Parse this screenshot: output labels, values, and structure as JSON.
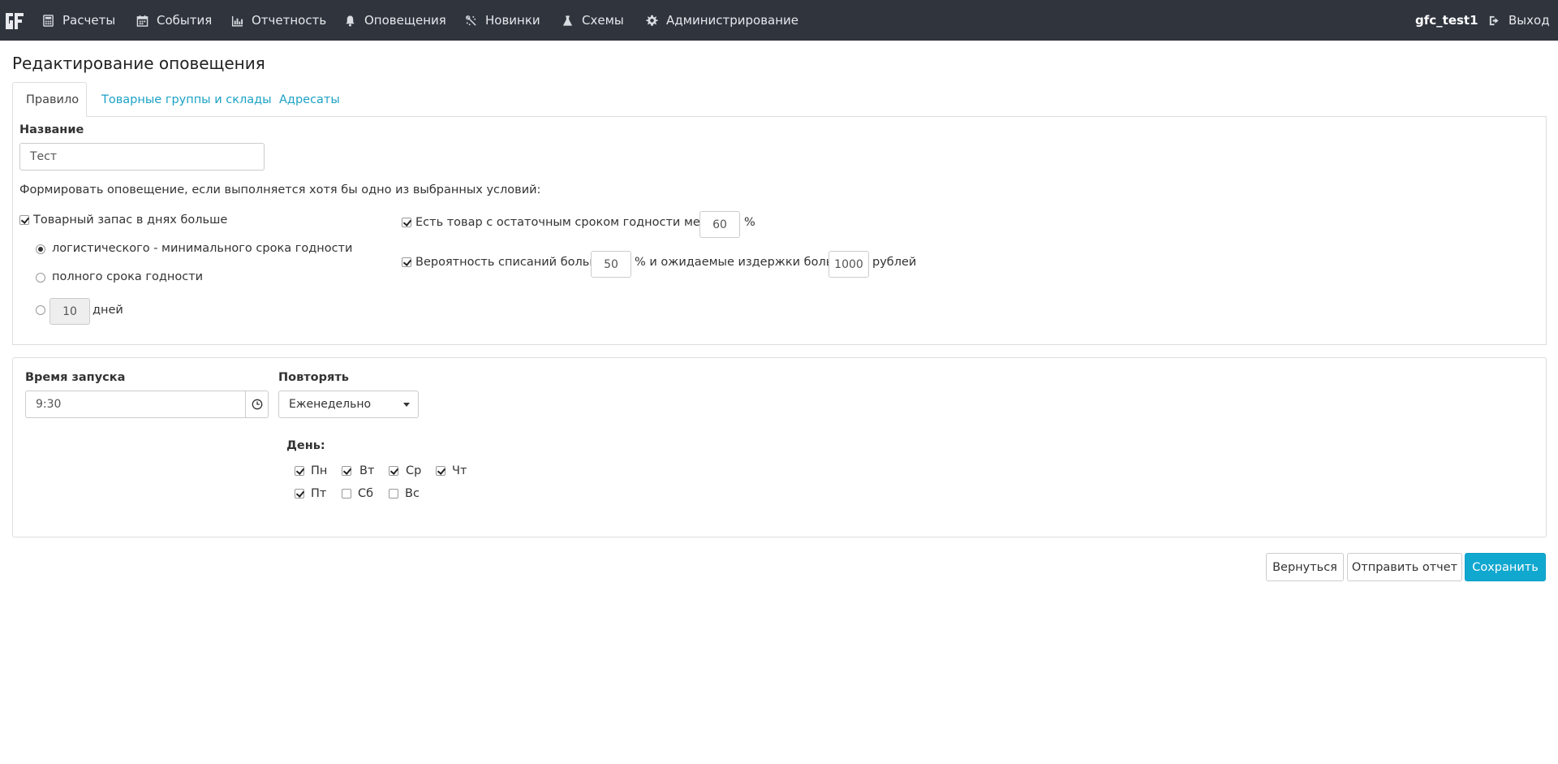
{
  "navbar": {
    "logo_text": "GF",
    "items": [
      {
        "label": "Расчеты",
        "icon": "calculator-icon"
      },
      {
        "label": "События",
        "icon": "calendar-icon"
      },
      {
        "label": "Отчетность",
        "icon": "bar-chart-icon"
      },
      {
        "label": "Оповещения",
        "icon": "bell-icon"
      },
      {
        "label": "Новинки",
        "icon": "sparkle-icon"
      },
      {
        "label": "Схемы",
        "icon": "flask-icon"
      },
      {
        "label": "Администрирование",
        "icon": "gear-icon"
      }
    ],
    "user": "gfc_test1",
    "logout": "Выход"
  },
  "page_title": "Редактирование оповещения",
  "tabs": [
    {
      "label": "Правило",
      "active": true
    },
    {
      "label": "Товарные группы и склады",
      "active": false
    },
    {
      "label": "Адресаты",
      "active": false
    }
  ],
  "rule": {
    "name_label": "Название",
    "name_value": "Тест",
    "condition_text": "Формировать оповещение, если выполняется хотя бы одно из выбранных условий:",
    "stock_days": {
      "label": "Товарный запас в днях больше",
      "checked": true,
      "options": [
        {
          "label": "логистического - минимального срока годности",
          "checked": true
        },
        {
          "label": "полного срока годности",
          "checked": false
        }
      ],
      "custom_days_value": "10",
      "days_label": "дней"
    },
    "shelf_life": {
      "label": "Есть товар с остаточным сроком годности меньше",
      "value": "60",
      "unit": "%"
    },
    "writeoff": {
      "label": "Вероятность списаний больше",
      "value": "50",
      "mid_label": "% и ожидаемые издержки больше",
      "cost_value": "1000",
      "unit": "рублей"
    }
  },
  "schedule": {
    "time_label": "Время запуска",
    "time_value": "9:30",
    "repeat_label": "Повторять",
    "repeat_value": "Еженедельно",
    "day_label": "День:",
    "days": [
      {
        "label": "Пн",
        "checked": true
      },
      {
        "label": "Вт",
        "checked": true
      },
      {
        "label": "Ср",
        "checked": true
      },
      {
        "label": "Чт",
        "checked": true
      },
      {
        "label": "Пт",
        "checked": true
      },
      {
        "label": "Сб",
        "checked": false
      },
      {
        "label": "Вс",
        "checked": false
      }
    ]
  },
  "actions": {
    "back": "Вернуться",
    "send_report": "Отправить отчет",
    "save": "Сохранить"
  },
  "colors": {
    "navbar_bg": "#2f343d",
    "accent": "#11a8d0",
    "link": "#1ba2c5"
  }
}
